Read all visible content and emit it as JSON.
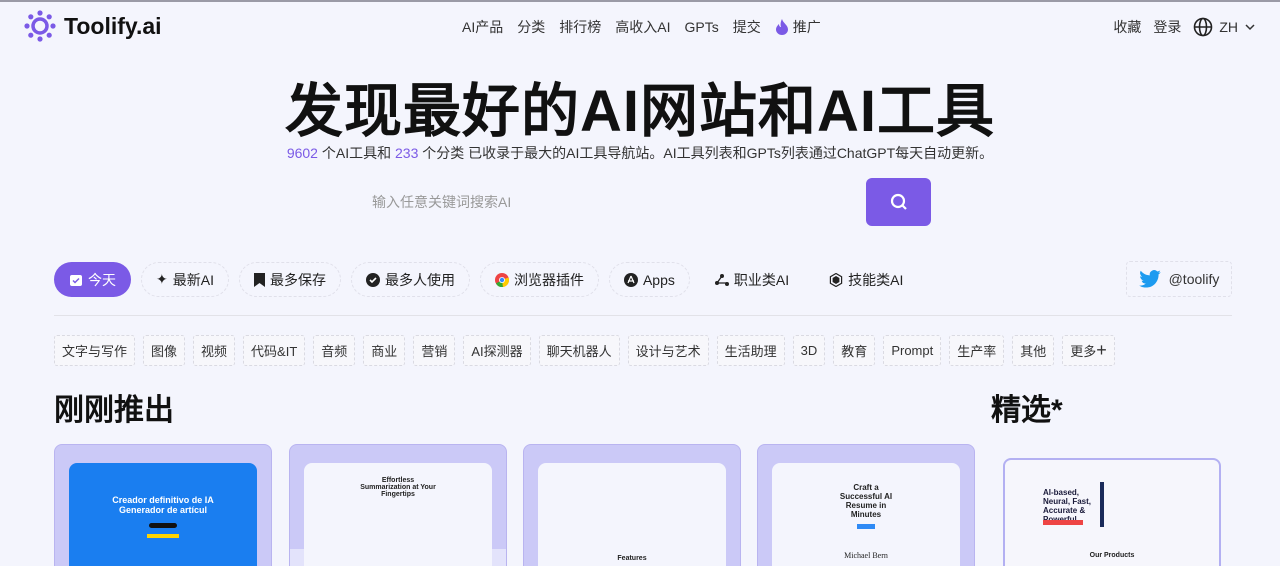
{
  "header": {
    "logo": "Toolify.ai",
    "nav": [
      "AI产品",
      "分类",
      "排行榜",
      "高收入AI",
      "GPTs",
      "提交",
      "推广"
    ],
    "right": {
      "favorites": "收藏",
      "login": "登录",
      "lang": "ZH"
    }
  },
  "hero": {
    "title": "发现最好的AI网站和AI工具",
    "tool_count": "9602",
    "sub_a": " 个AI工具和 ",
    "category_count": "233",
    "sub_b": " 个分类 已收录于最大的AI工具导航站。AI工具列表和GPTs列表通过ChatGPT每天自动更新。",
    "search_placeholder": "输入任意关键词搜索AI"
  },
  "filters": [
    "今天",
    "最新AI",
    "最多保存",
    "最多人使用",
    "浏览器插件",
    "Apps",
    "职业类AI",
    "技能类AI"
  ],
  "twitter": "@toolify",
  "tags": [
    "文字与写作",
    "图像",
    "视频",
    "代码&IT",
    "音频",
    "商业",
    "营销",
    "AI探测器",
    "聊天机器人",
    "设计与艺术",
    "生活助理",
    "3D",
    "教育",
    "Prompt",
    "生产率",
    "其他",
    "更多"
  ],
  "sections": {
    "new": "刚刚推出",
    "featured": "精选*"
  },
  "cards": [
    {
      "title": "Creador definitivo de IA Generador de artícul"
    },
    {
      "title": "Effortless Summarization at Your Fingertips"
    },
    {
      "title": "Features"
    },
    {
      "title": "Craft a Successful AI Resume in Minutes",
      "name": "Michael Bern"
    }
  ],
  "featured_card": {
    "title": "AI-based, Neural, Fast, Accurate & Powerful",
    "footer": "Our Products"
  },
  "colors": {
    "accent": "#7b5ae6",
    "card_bg": "#cbc9f7"
  }
}
